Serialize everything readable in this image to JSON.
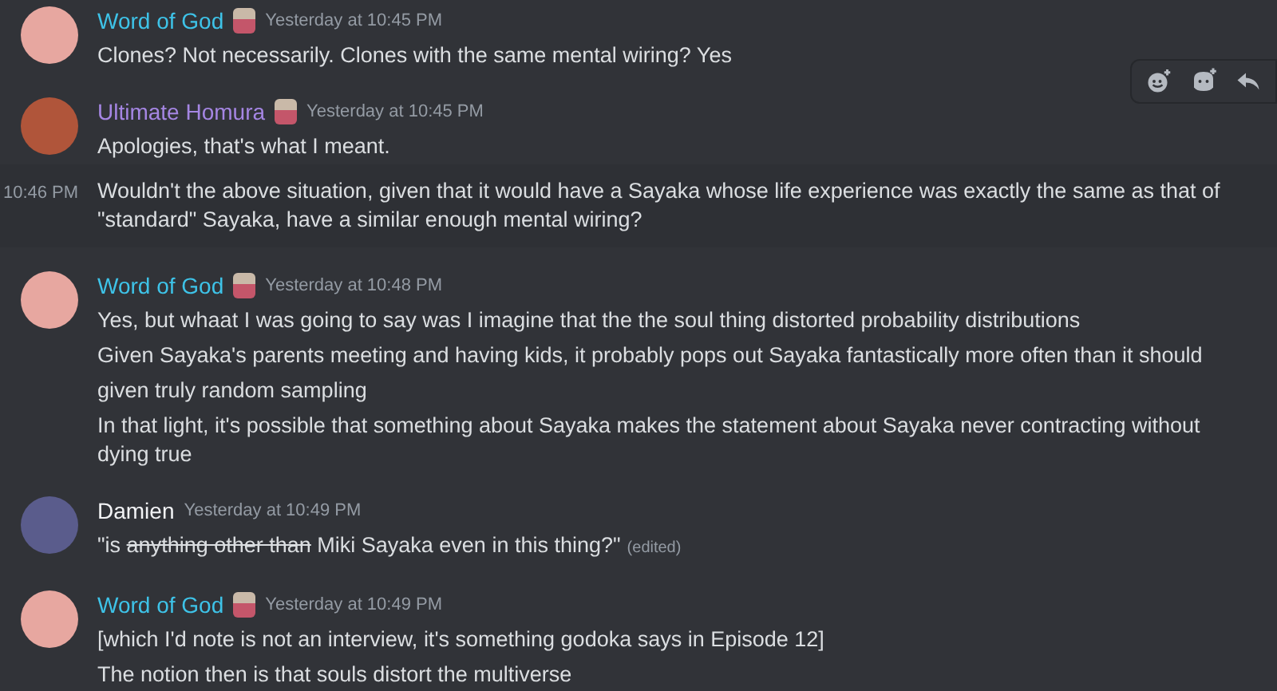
{
  "messages": [
    {
      "author": "Word of God",
      "color": "#3ec3e8",
      "role_icon": true,
      "timestamp": "Yesterday at 10:45 PM",
      "lines": [
        {
          "segments": [
            {
              "text": "Clones? Not necessarily. Clones with the same mental wiring? Yes",
              "struck": false
            }
          ],
          "highlighted": false
        }
      ]
    },
    {
      "author": "Ultimate Homura",
      "color": "#a586e3",
      "role_icon": true,
      "timestamp": "Yesterday at 10:45 PM",
      "lines": [
        {
          "segments": [
            {
              "text": "Apologies, that's what I meant.",
              "struck": false
            }
          ],
          "highlighted": false
        },
        {
          "segments": [
            {
              "text": "Wouldn't the above situation, given that it would have a Sayaka whose life experience was exactly the same as that of \"standard\" Sayaka, have a similar enough mental wiring?",
              "struck": false
            }
          ],
          "highlighted": true,
          "hover_time": "10:46 PM"
        }
      ]
    },
    {
      "author": "Word of God",
      "color": "#3ec3e8",
      "role_icon": true,
      "timestamp": "Yesterday at 10:48 PM",
      "lines": [
        {
          "segments": [
            {
              "text": "Yes, but whaat I was going to say was I imagine that the the soul thing distorted probability distributions",
              "struck": false
            }
          ],
          "highlighted": false
        },
        {
          "segments": [
            {
              "text": "Given Sayaka's parents meeting and having kids, it probably pops out Sayaka fantastically more often than it should",
              "struck": false
            }
          ],
          "highlighted": false
        },
        {
          "segments": [
            {
              "text": "given truly random sampling",
              "struck": false
            }
          ],
          "highlighted": false
        },
        {
          "segments": [
            {
              "text": "In that light, it's possible that something about Sayaka makes the statement about Sayaka never contracting without dying true",
              "struck": false
            }
          ],
          "highlighted": false
        }
      ]
    },
    {
      "author": "Damien",
      "color": "#f2f3f5",
      "role_icon": false,
      "timestamp": "Yesterday at 10:49 PM",
      "lines": [
        {
          "segments": [
            {
              "text": "\"is ",
              "struck": false
            },
            {
              "text": "anything other than",
              "struck": true
            },
            {
              "text": " Miki Sayaka even in this thing?\"",
              "struck": false
            }
          ],
          "edited": "(edited)",
          "highlighted": false
        }
      ]
    },
    {
      "author": "Word of God",
      "color": "#3ec3e8",
      "role_icon": true,
      "timestamp": "Yesterday at 10:49 PM",
      "lines": [
        {
          "segments": [
            {
              "text": "[which I'd note is not an interview, it's something godoka says in Episode 12]",
              "struck": false
            }
          ],
          "highlighted": false
        },
        {
          "segments": [
            {
              "text": "The notion then is that souls distort the  multiverse",
              "struck": false
            }
          ],
          "highlighted": false
        }
      ]
    }
  ]
}
